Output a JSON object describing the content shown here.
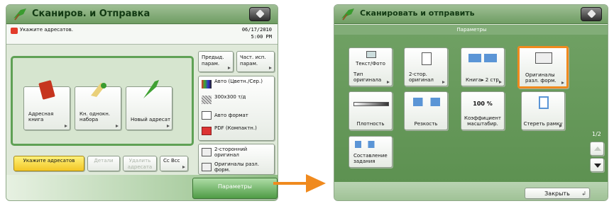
{
  "left": {
    "title": "Сканиров. и Отправка",
    "message": "Укажите адресатов.",
    "datetime": {
      "date": "06/17/2010",
      "time": "5:00 PM"
    },
    "tabs": [
      "Предыд. парам.",
      "Част. исп. парам."
    ],
    "destinations": [
      {
        "label": "Адресная книга"
      },
      {
        "label": "Кн. однокн. набора"
      },
      {
        "label": "Новый адресат"
      }
    ],
    "settings": [
      {
        "label": "Авто (Цветн./Сер.)",
        "icon": "color-mode-icon"
      },
      {
        "label": "300x300 т/д",
        "icon": "resolution-icon"
      },
      {
        "label": "Авто формат",
        "icon": "paper-size-icon"
      },
      {
        "label": "PDF (Компактн.)",
        "icon": "pdf-icon"
      },
      {
        "label": "2-сторонний оригинал",
        "icon": "two-sided-icon"
      },
      {
        "label": "Оригиналы разл. форм.",
        "icon": "mixed-originals-icon"
      }
    ],
    "bottom_buttons": {
      "specify": "Укажите адресатов",
      "details": "Детали",
      "delete": "Удалить адресата",
      "ccbcc": "Cc Bcc",
      "options": "Параметры"
    }
  },
  "right": {
    "title": "Сканировать и отправить",
    "header": "Параметры",
    "tiles": [
      {
        "label": "Тип оригинала",
        "value": "Текст/Фото",
        "icon": "text-photo-icon"
      },
      {
        "label": "2-стор. оригинал",
        "icon": "two-sided-original-icon"
      },
      {
        "label": "Книга▸ 2 стр.",
        "icon": "book-two-pages-icon"
      },
      {
        "label": "Оригиналы разл. форм.",
        "icon": "different-size-originals-icon"
      },
      {
        "label": "Плотность",
        "icon": "density-slider-icon"
      },
      {
        "label": "Резкость",
        "icon": "sharpness-icon"
      },
      {
        "label": "Коэффициент масштабир.",
        "value": "100 %"
      },
      {
        "label": "Стереть рамку",
        "icon": "erase-frame-icon"
      },
      {
        "label": "Составление задания",
        "icon": "job-build-icon"
      }
    ],
    "page_indicator": "1/2",
    "close": "Закрыть"
  },
  "colors": {
    "highlight": "#f08a1e",
    "title_green": "#6f9d63"
  }
}
